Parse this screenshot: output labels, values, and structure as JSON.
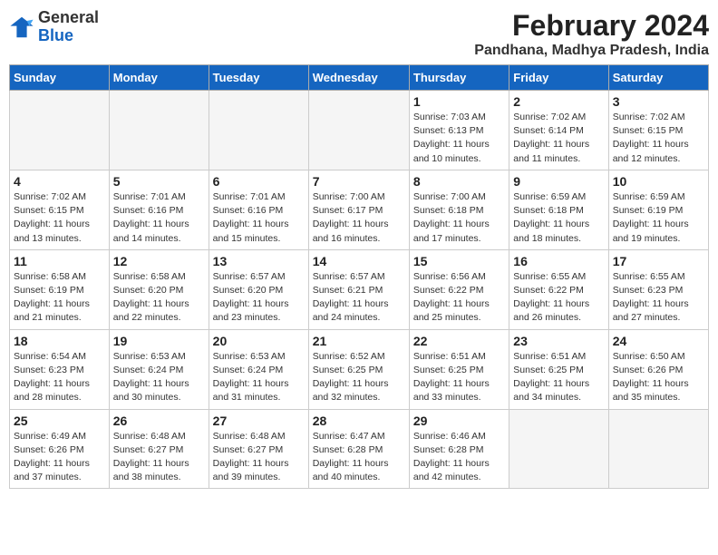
{
  "logo": {
    "text_general": "General",
    "text_blue": "Blue"
  },
  "title": "February 2024",
  "subtitle": "Pandhana, Madhya Pradesh, India",
  "days_of_week": [
    "Sunday",
    "Monday",
    "Tuesday",
    "Wednesday",
    "Thursday",
    "Friday",
    "Saturday"
  ],
  "weeks": [
    [
      {
        "day": "",
        "info": ""
      },
      {
        "day": "",
        "info": ""
      },
      {
        "day": "",
        "info": ""
      },
      {
        "day": "",
        "info": ""
      },
      {
        "day": "1",
        "info": "Sunrise: 7:03 AM\nSunset: 6:13 PM\nDaylight: 11 hours\nand 10 minutes."
      },
      {
        "day": "2",
        "info": "Sunrise: 7:02 AM\nSunset: 6:14 PM\nDaylight: 11 hours\nand 11 minutes."
      },
      {
        "day": "3",
        "info": "Sunrise: 7:02 AM\nSunset: 6:15 PM\nDaylight: 11 hours\nand 12 minutes."
      }
    ],
    [
      {
        "day": "4",
        "info": "Sunrise: 7:02 AM\nSunset: 6:15 PM\nDaylight: 11 hours\nand 13 minutes."
      },
      {
        "day": "5",
        "info": "Sunrise: 7:01 AM\nSunset: 6:16 PM\nDaylight: 11 hours\nand 14 minutes."
      },
      {
        "day": "6",
        "info": "Sunrise: 7:01 AM\nSunset: 6:16 PM\nDaylight: 11 hours\nand 15 minutes."
      },
      {
        "day": "7",
        "info": "Sunrise: 7:00 AM\nSunset: 6:17 PM\nDaylight: 11 hours\nand 16 minutes."
      },
      {
        "day": "8",
        "info": "Sunrise: 7:00 AM\nSunset: 6:18 PM\nDaylight: 11 hours\nand 17 minutes."
      },
      {
        "day": "9",
        "info": "Sunrise: 6:59 AM\nSunset: 6:18 PM\nDaylight: 11 hours\nand 18 minutes."
      },
      {
        "day": "10",
        "info": "Sunrise: 6:59 AM\nSunset: 6:19 PM\nDaylight: 11 hours\nand 19 minutes."
      }
    ],
    [
      {
        "day": "11",
        "info": "Sunrise: 6:58 AM\nSunset: 6:19 PM\nDaylight: 11 hours\nand 21 minutes."
      },
      {
        "day": "12",
        "info": "Sunrise: 6:58 AM\nSunset: 6:20 PM\nDaylight: 11 hours\nand 22 minutes."
      },
      {
        "day": "13",
        "info": "Sunrise: 6:57 AM\nSunset: 6:20 PM\nDaylight: 11 hours\nand 23 minutes."
      },
      {
        "day": "14",
        "info": "Sunrise: 6:57 AM\nSunset: 6:21 PM\nDaylight: 11 hours\nand 24 minutes."
      },
      {
        "day": "15",
        "info": "Sunrise: 6:56 AM\nSunset: 6:22 PM\nDaylight: 11 hours\nand 25 minutes."
      },
      {
        "day": "16",
        "info": "Sunrise: 6:55 AM\nSunset: 6:22 PM\nDaylight: 11 hours\nand 26 minutes."
      },
      {
        "day": "17",
        "info": "Sunrise: 6:55 AM\nSunset: 6:23 PM\nDaylight: 11 hours\nand 27 minutes."
      }
    ],
    [
      {
        "day": "18",
        "info": "Sunrise: 6:54 AM\nSunset: 6:23 PM\nDaylight: 11 hours\nand 28 minutes."
      },
      {
        "day": "19",
        "info": "Sunrise: 6:53 AM\nSunset: 6:24 PM\nDaylight: 11 hours\nand 30 minutes."
      },
      {
        "day": "20",
        "info": "Sunrise: 6:53 AM\nSunset: 6:24 PM\nDaylight: 11 hours\nand 31 minutes."
      },
      {
        "day": "21",
        "info": "Sunrise: 6:52 AM\nSunset: 6:25 PM\nDaylight: 11 hours\nand 32 minutes."
      },
      {
        "day": "22",
        "info": "Sunrise: 6:51 AM\nSunset: 6:25 PM\nDaylight: 11 hours\nand 33 minutes."
      },
      {
        "day": "23",
        "info": "Sunrise: 6:51 AM\nSunset: 6:25 PM\nDaylight: 11 hours\nand 34 minutes."
      },
      {
        "day": "24",
        "info": "Sunrise: 6:50 AM\nSunset: 6:26 PM\nDaylight: 11 hours\nand 35 minutes."
      }
    ],
    [
      {
        "day": "25",
        "info": "Sunrise: 6:49 AM\nSunset: 6:26 PM\nDaylight: 11 hours\nand 37 minutes."
      },
      {
        "day": "26",
        "info": "Sunrise: 6:48 AM\nSunset: 6:27 PM\nDaylight: 11 hours\nand 38 minutes."
      },
      {
        "day": "27",
        "info": "Sunrise: 6:48 AM\nSunset: 6:27 PM\nDaylight: 11 hours\nand 39 minutes."
      },
      {
        "day": "28",
        "info": "Sunrise: 6:47 AM\nSunset: 6:28 PM\nDaylight: 11 hours\nand 40 minutes."
      },
      {
        "day": "29",
        "info": "Sunrise: 6:46 AM\nSunset: 6:28 PM\nDaylight: 11 hours\nand 42 minutes."
      },
      {
        "day": "",
        "info": ""
      },
      {
        "day": "",
        "info": ""
      }
    ]
  ]
}
